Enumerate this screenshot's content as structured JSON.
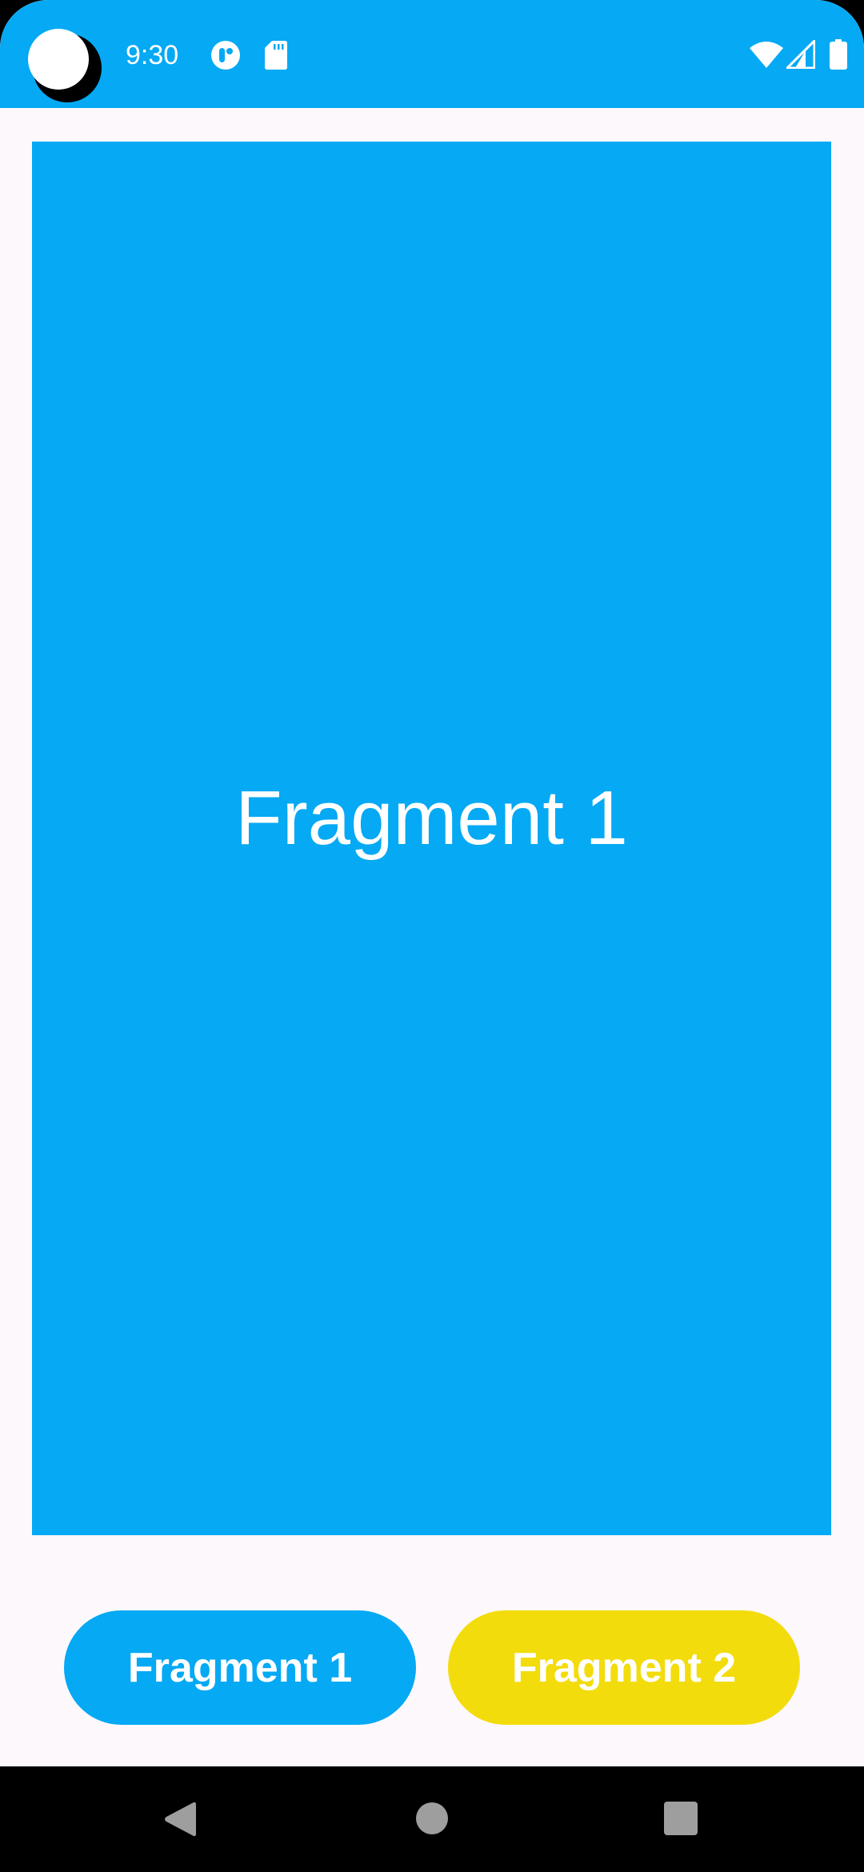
{
  "status_bar": {
    "time": "9:30",
    "background_color": "#05A9F4",
    "icons": [
      "media-icon",
      "sd-card-icon",
      "wifi-icon",
      "cell-signal-icon",
      "battery-icon"
    ]
  },
  "fragment": {
    "label": "Fragment 1",
    "background_color": "#05A9F4"
  },
  "buttons": [
    {
      "label": "Fragment 1",
      "color": "#05A9F4"
    },
    {
      "label": "Fragment 2",
      "color": "#F3DC0C"
    }
  ],
  "nav_bar": {
    "icons": [
      "back-icon",
      "home-icon",
      "recents-icon"
    ]
  }
}
